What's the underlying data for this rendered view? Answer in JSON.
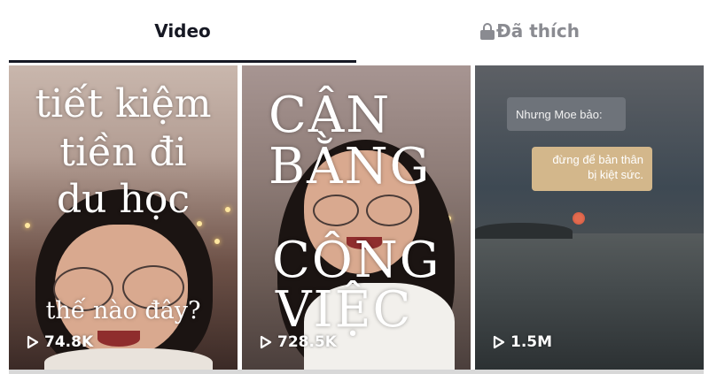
{
  "tabs": {
    "video_label": "Video",
    "liked_label": "Đã thích",
    "liked_icon": "lock-icon",
    "active": "video"
  },
  "videos": [
    {
      "overlay_lines": [
        "tiết kiệm",
        "tiền đi",
        "du học"
      ],
      "overlay_sub": "thế nào đây?",
      "views": "74.8K",
      "icon": "play-icon"
    },
    {
      "overlay_lines": [
        "CÂN",
        "BẰNG",
        "CÔNG",
        "VIỆC"
      ],
      "views": "728.5K",
      "icon": "play-icon"
    },
    {
      "bubbles": [
        "Nhưng Moe bảo:",
        "đừng để bản thân bị kiệt sức."
      ],
      "views": "1.5M",
      "icon": "play-icon"
    }
  ],
  "colors": {
    "text_primary": "#161823",
    "text_muted": "#8a8b91",
    "underline": "#161823"
  }
}
